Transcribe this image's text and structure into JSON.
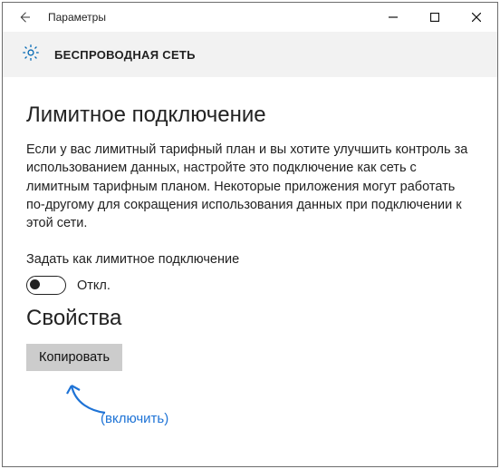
{
  "titlebar": {
    "app_title": "Параметры"
  },
  "header": {
    "title": "БЕСПРОВОДНАЯ СЕТЬ"
  },
  "content": {
    "section_title": "Лимитное подключение",
    "description": "Если у вас лимитный тарифный план и вы хотите улучшить контроль за использованием данных, настройте это подключение как сеть с лимитным тарифным планом. Некоторые приложения могут работать по-другому для сокращения использования данных при подключении к этой сети.",
    "setting_label": "Задать как лимитное подключение",
    "toggle_state": "Откл.",
    "annotation": "(включить)",
    "properties_title": "Свойства",
    "copy_button": "Копировать"
  }
}
